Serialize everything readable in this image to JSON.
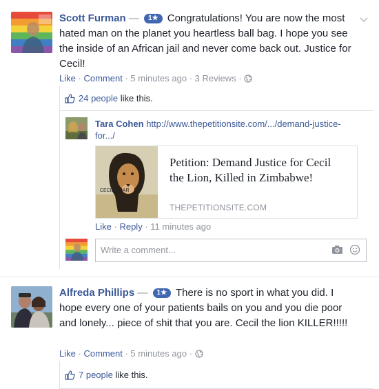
{
  "comment1": {
    "author": "Scott Furman",
    "dash": "—",
    "badge": "1★",
    "text": "Congratulations! You are now the most hated man on the planet you heartless ball bag. I hope you see the inside of an African jail and never come back out. Justice for Cecil!",
    "actions": {
      "like": "Like",
      "sep1": "·",
      "comment": "Comment",
      "sep2": "·",
      "time": "5 minutes ago",
      "sep3": "·",
      "reviews": "3 Reviews",
      "sep4": "·"
    },
    "likes": {
      "count": "24 people",
      "suffix": " like this."
    },
    "reply": {
      "author": "Tara Cohen",
      "link_text": "http://www.thepetitionsite.com/.../demand-justice-for.../",
      "card": {
        "title": "Petition: Demand Justice for Cecil the Lion, Killed in Zimbabwe!",
        "domain": "THEPETITIONSITE.COM",
        "image_caption": "CECIL ROAR"
      },
      "actions": {
        "like": "Like",
        "sep1": "·",
        "reply": "Reply",
        "sep2": "·",
        "time": "11 minutes ago"
      }
    },
    "write_placeholder": "Write a comment..."
  },
  "comment2": {
    "author": "Alfreda Phillips",
    "dash": "—",
    "badge": "1★",
    "text": "There is no sport in what you did. I hope every one of your patients bails on you and you die poor and lonely... piece of shit that you are. Cecil the lion KILLER!!!!!",
    "actions": {
      "like": "Like",
      "sep1": "·",
      "comment": "Comment",
      "sep2": "·",
      "time": "5 minutes ago",
      "sep3": "·"
    },
    "likes": {
      "count": "7 people",
      "suffix": " like this."
    }
  },
  "icons": [
    "chevron-down-icon",
    "globe-icon",
    "thumbs-up-icon",
    "camera-icon",
    "emoji-icon"
  ],
  "colors": {
    "link": "#3b5998",
    "badge": "#4267b2",
    "muted": "#90949c",
    "border": "#dddfe2"
  }
}
